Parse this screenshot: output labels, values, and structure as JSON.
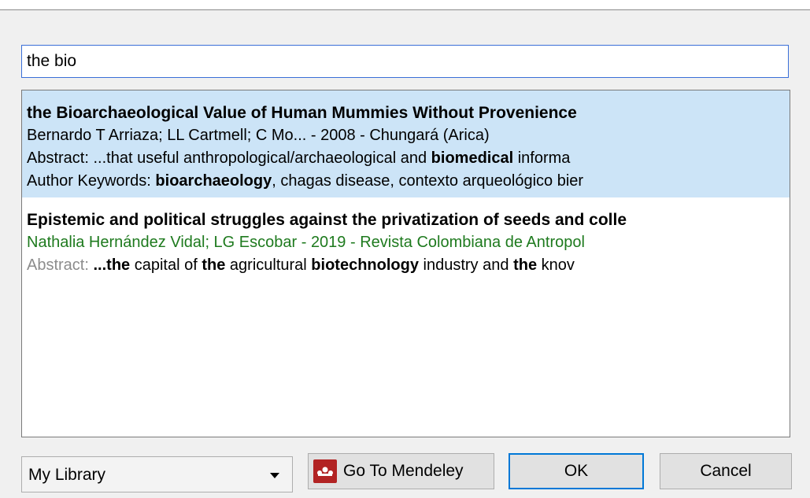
{
  "search": {
    "value": "the bio"
  },
  "results": [
    {
      "title": "the Bioarchaeological Value of Human Mummies Without Provenience",
      "meta": "Bernardo T Arriaza; LL Cartmell; C Mo... - 2008 - Chungará (Arica)",
      "abstract_label": "Abstract:",
      "abstract_pre": "...that useful anthropological/archaeological and",
      "abstract_bold": "biomedical",
      "abstract_post": "informa",
      "keywords_label": "Author Keywords:",
      "keywords_bold": "bioarchaeology",
      "keywords_post": ", chagas disease, contexto arqueológico bier"
    },
    {
      "title": "Epistemic and political struggles against the privatization of seeds and colle",
      "meta": "Nathalia Hernández Vidal; LG Escobar - 2019 - Revista Colombiana de Antropol",
      "abstract_label": "Abstract:",
      "a1": "...the",
      "a2": "capital of",
      "a3": "the",
      "a4": "agricultural",
      "a5": "biotechnology",
      "a6": "industry and",
      "a7": "the",
      "a8": "knov"
    }
  ],
  "footer": {
    "library_select": "My Library",
    "mendeley_button": "Go To Mendeley",
    "ok_button": "OK",
    "cancel_button": "Cancel"
  },
  "colors": {
    "selection": "#cce4f7",
    "meta_green": "#1e7a1e",
    "accent": "#0078d7",
    "mendeley_red": "#b22323"
  },
  "icons": {
    "dropdown": "chevron-down-icon",
    "mendeley": "mendeley-logo-icon"
  }
}
